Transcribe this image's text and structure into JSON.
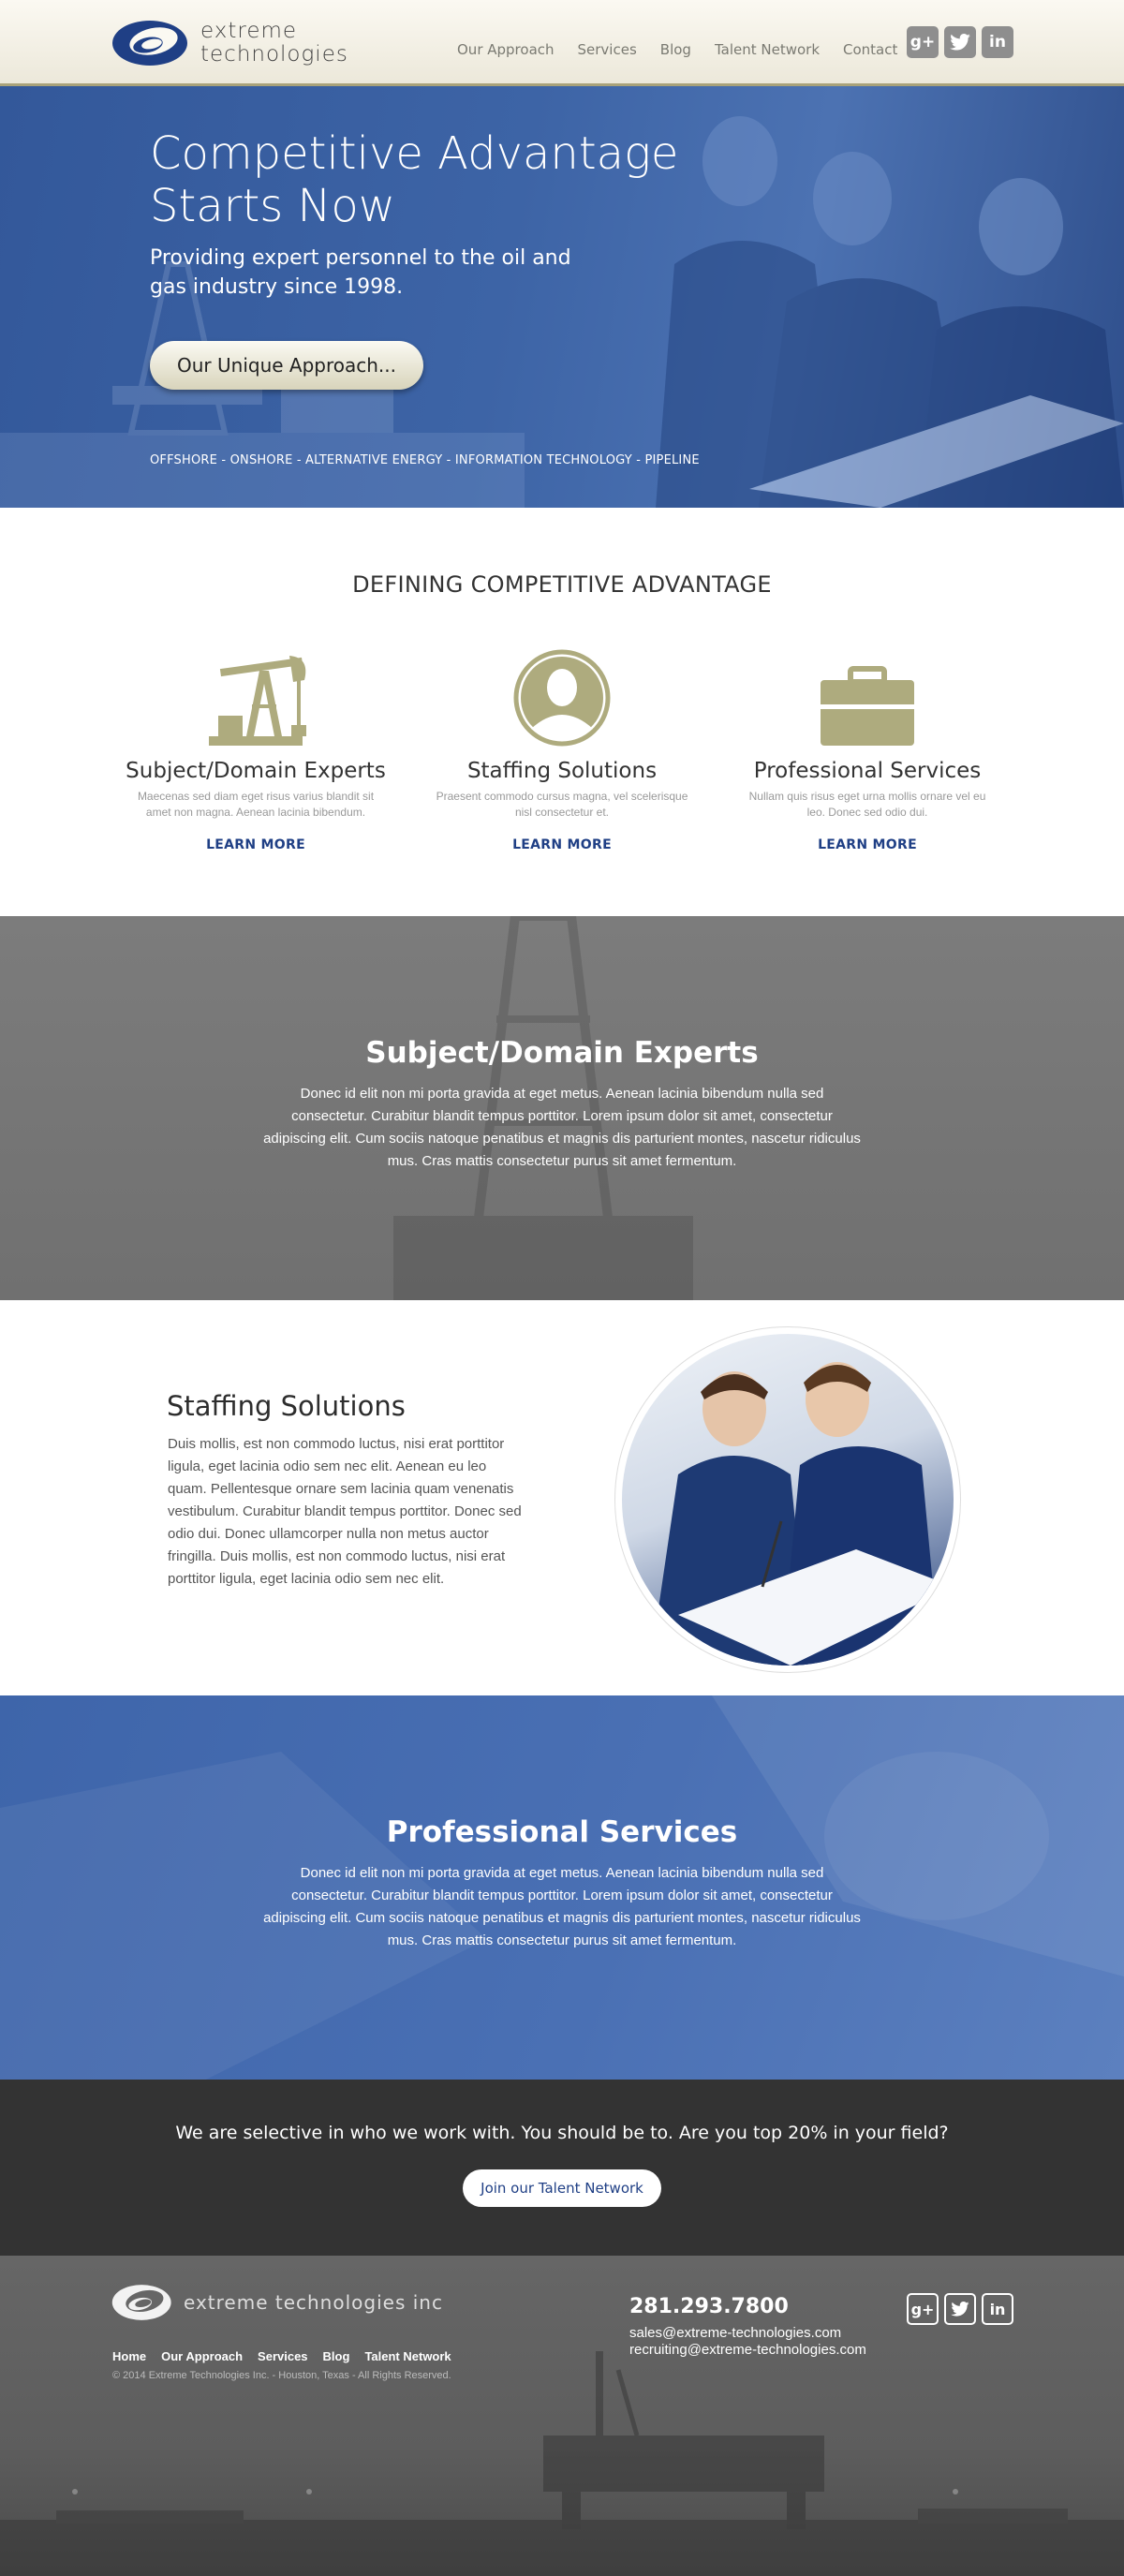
{
  "header": {
    "logo_line1": "extreme",
    "logo_line2": "technologies",
    "nav": [
      "Our Approach",
      "Services",
      "Blog",
      "Talent Network",
      "Contact"
    ],
    "social": [
      {
        "icon": "google-plus-icon",
        "glyph": "g+"
      },
      {
        "icon": "twitter-icon",
        "glyph": "t"
      },
      {
        "icon": "linkedin-icon",
        "glyph": "in"
      }
    ]
  },
  "hero": {
    "title": "Competitive Advantage Starts Now",
    "subtitle": "Providing expert personnel to the oil and gas industry since 1998.",
    "button": "Our Unique Approach...",
    "sectors": "OFFSHORE - ONSHORE - ALTERNATIVE ENERGY - INFORMATION TECHNOLOGY - PIPELINE"
  },
  "defining": {
    "title": "DEFINING COMPETITIVE ADVANTAGE",
    "columns": [
      {
        "icon": "oil-pump-icon",
        "title": "Subject/Domain Experts",
        "text": "Maecenas sed diam eget risus varius blandit sit amet non magna. Aenean lacinia bibendum.",
        "link": "LEARN MORE"
      },
      {
        "icon": "person-icon",
        "title": "Staffing Solutions",
        "text": "Praesent commodo cursus magna, vel scelerisque nisl consectetur et.",
        "link": "LEARN MORE"
      },
      {
        "icon": "briefcase-icon",
        "title": "Professional Services",
        "text": "Nullam quis risus eget urna mollis ornare vel eu leo. Donec sed odio dui.",
        "link": "LEARN MORE"
      }
    ]
  },
  "domain_section": {
    "title": "Subject/Domain Experts",
    "body": "Donec id elit non mi porta gravida at eget metus. Aenean lacinia bibendum nulla sed consectetur. Curabitur blandit tempus porttitor. Lorem ipsum dolor sit amet, consectetur adipiscing elit. Cum sociis natoque penatibus et magnis dis parturient montes, nascetur ridiculus mus. Cras mattis consectetur purus sit amet fermentum."
  },
  "staffing_section": {
    "title": "Staffing Solutions",
    "body": "Duis mollis, est non commodo luctus, nisi erat porttitor ligula, eget lacinia odio sem nec elit. Aenean eu leo quam. Pellentesque ornare sem lacinia quam venenatis vestibulum. Curabitur blandit tempus porttitor. Donec sed odio dui. Donec ullamcorper nulla non metus auctor fringilla. Duis mollis, est non commodo luctus, nisi erat porttitor ligula, eget lacinia odio sem nec elit."
  },
  "services_section": {
    "title": "Professional Services",
    "body": "Donec id elit non mi porta gravida at eget metus. Aenean lacinia bibendum nulla sed consectetur. Curabitur blandit tempus porttitor. Lorem ipsum dolor sit amet, consectetur adipiscing elit. Cum sociis natoque penatibus et magnis dis parturient montes, nascetur ridiculus mus. Cras mattis consectetur purus sit amet fermentum."
  },
  "cta": {
    "text": "We are selective in who we work with. You should be to. Are you top 20% in your field?",
    "button": "Join our Talent Network"
  },
  "footer": {
    "logo_text": "extreme technologies inc",
    "nav": [
      "Home",
      "Our Approach",
      "Services",
      "Blog",
      "Talent Network"
    ],
    "copyright": "© 2014 Extreme Technologies Inc. - Houston, Texas - All Rights Reserved.",
    "phone": "281.293.7800",
    "email_sales": "sales@extreme-technologies.com",
    "email_recruiting": "recruiting@extreme-technologies.com"
  },
  "colors": {
    "brand_blue": "#1f3f85",
    "accent_khaki": "#aeab7e",
    "hero_blue": "#3d64a6",
    "grey_band": "#767676",
    "dark_band": "#333333"
  }
}
